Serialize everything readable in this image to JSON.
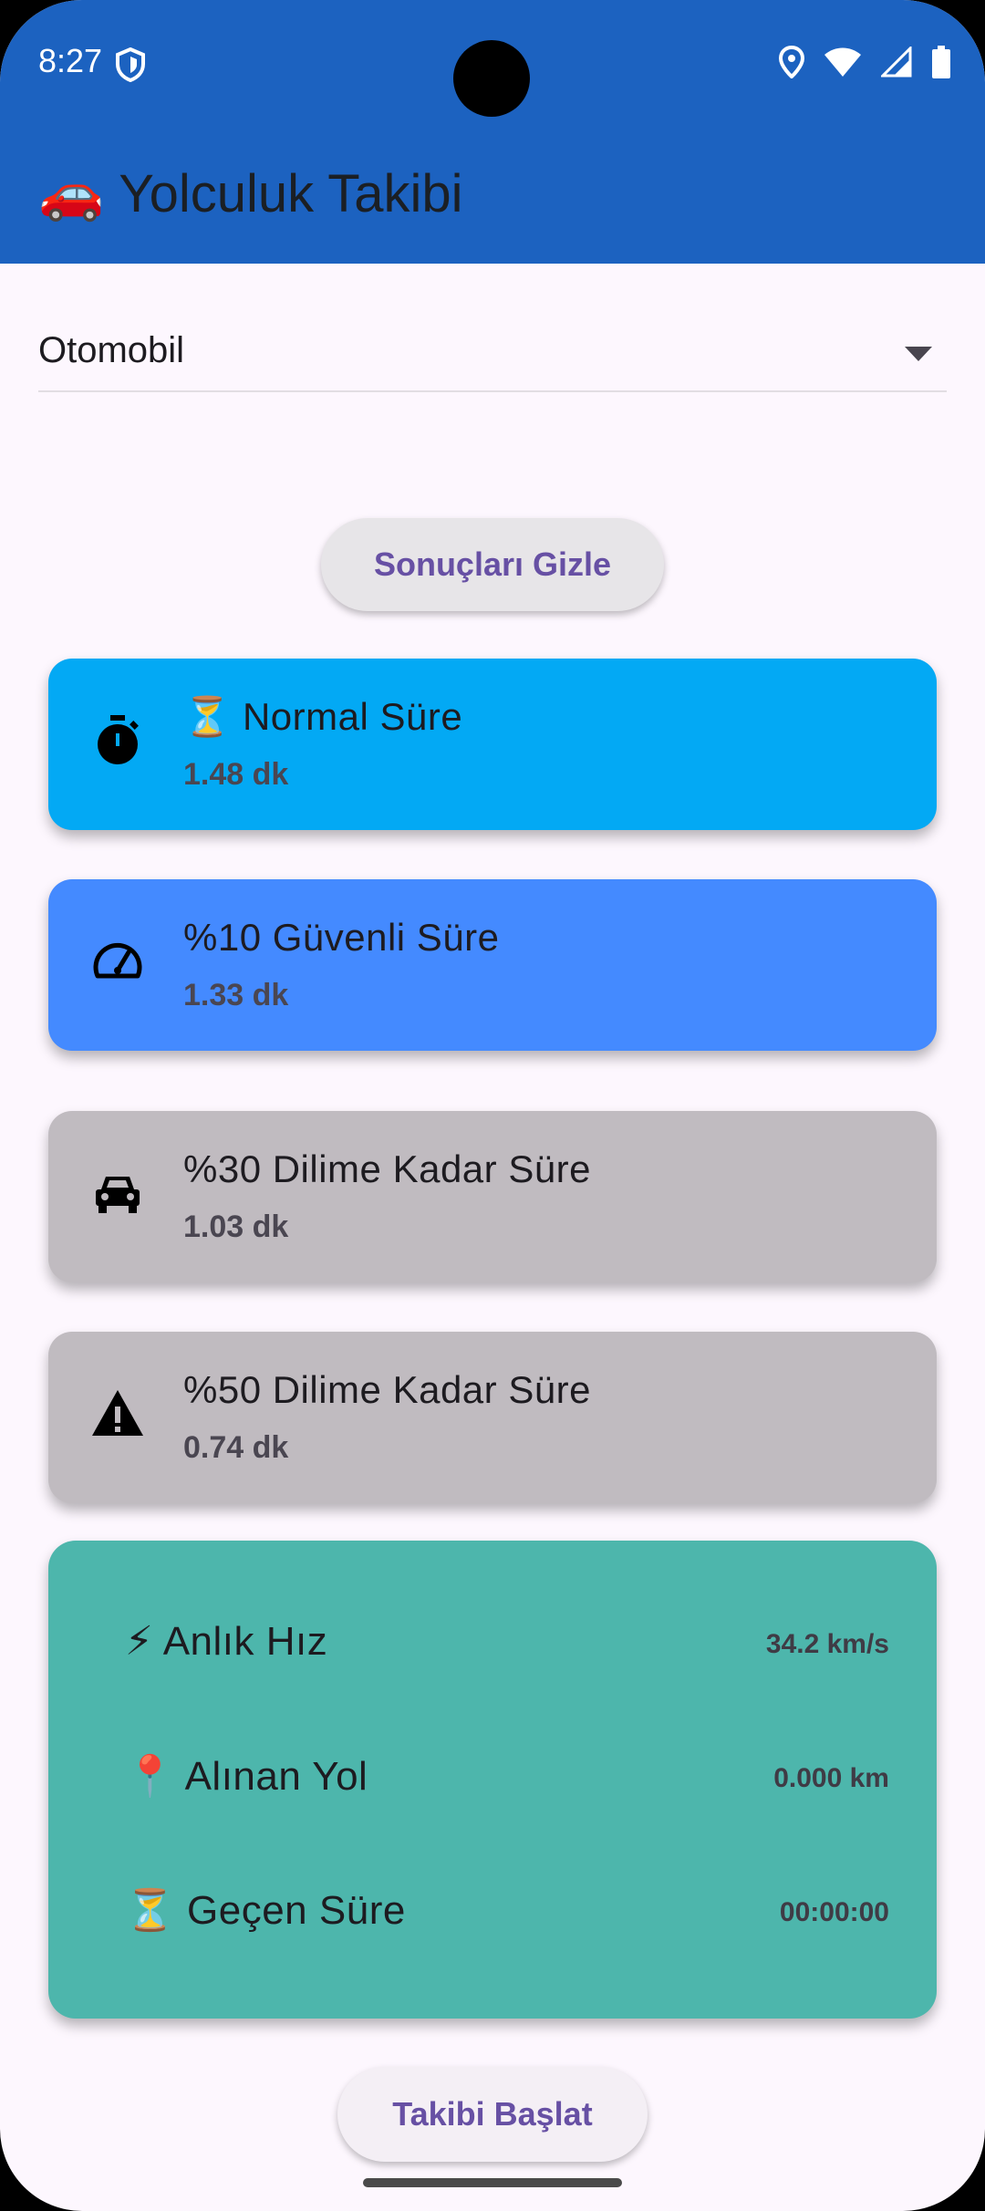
{
  "status_bar": {
    "time": "8:27"
  },
  "app_bar": {
    "emoji": "🚗",
    "title": "Yolculuk Takibi"
  },
  "vehicle_select": {
    "value": "Otomobil"
  },
  "hide_results_button": {
    "label": "Sonuçları Gizle"
  },
  "cards": [
    {
      "icon": "stopwatch-icon",
      "title": "⏳ Normal Süre",
      "value": "1.48 dk",
      "color": "#03a9f4"
    },
    {
      "icon": "speedometer-icon",
      "title": "%10 Güvenli Süre",
      "value": "1.33 dk",
      "color": "#448aff"
    },
    {
      "icon": "car-icon",
      "title": "%30 Dilime Kadar Süre",
      "value": "1.03 dk",
      "color": "#c0bbc0"
    },
    {
      "icon": "warning-icon",
      "title": "%50 Dilime Kadar Süre",
      "value": "0.74 dk",
      "color": "#c0bbc0"
    }
  ],
  "stats": {
    "color": "#4db6ac",
    "rows": [
      {
        "label": "⚡ Anlık Hız",
        "value": "34.2 km/s"
      },
      {
        "label": "📍 Alınan Yol",
        "value": "0.000 km"
      },
      {
        "label": "⏳ Geçen Süre",
        "value": "00:00:00"
      }
    ]
  },
  "start_button": {
    "label": "Takibi Başlat"
  }
}
